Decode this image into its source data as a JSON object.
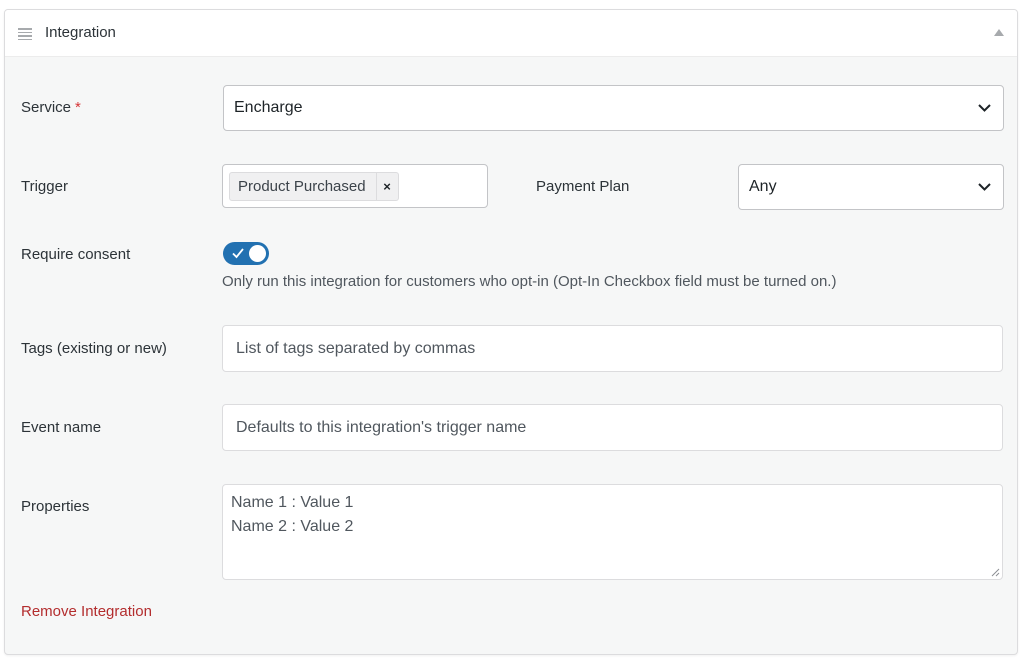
{
  "panel": {
    "title": "Integration",
    "icons": {
      "drag": "drag-handle-icon",
      "collapse": "collapse-arrow-icon"
    }
  },
  "fields": {
    "service": {
      "label": "Service",
      "required_marker": "*",
      "value": "Encharge"
    },
    "trigger": {
      "label": "Trigger",
      "tag": "Product Purchased",
      "remove_glyph": "×"
    },
    "payment_plan": {
      "label": "Payment Plan",
      "value": "Any"
    },
    "consent": {
      "label": "Require consent",
      "enabled": true,
      "help": "Only run this integration for customers who opt-in (Opt-In Checkbox field must be turned on.)"
    },
    "tags": {
      "label": "Tags (existing or new)",
      "placeholder": "List of tags separated by commas"
    },
    "event_name": {
      "label": "Event name",
      "placeholder": "Defaults to this integration's trigger name"
    },
    "properties": {
      "label": "Properties",
      "placeholder_lines": [
        "Name 1 : Value 1",
        "Name 2 : Value 2"
      ]
    }
  },
  "actions": {
    "remove_label": "Remove Integration"
  },
  "colors": {
    "toggle_on": "#2271b1",
    "required": "#d63638",
    "remove_link": "#b32d2e"
  }
}
